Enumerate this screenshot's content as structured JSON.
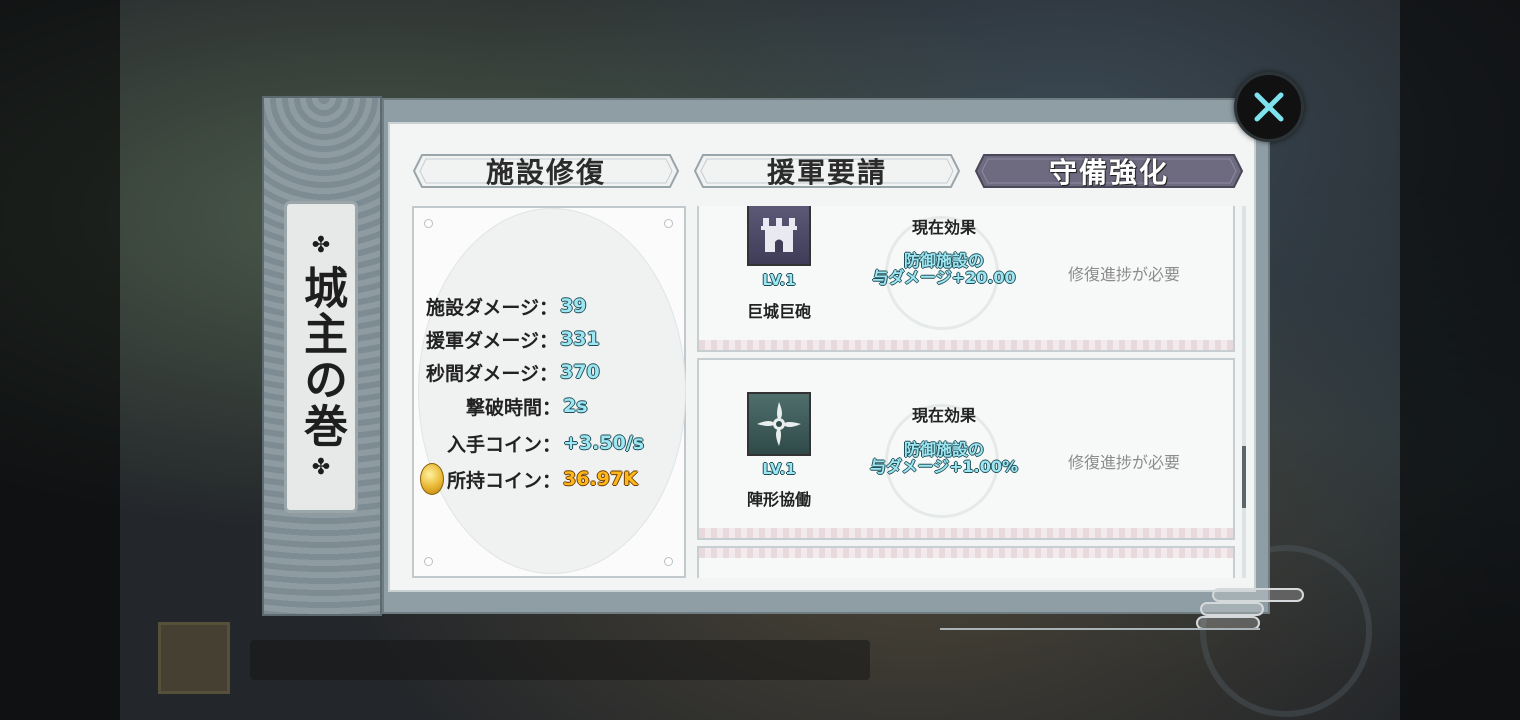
{
  "side_title": "城主の巻",
  "tabs": [
    {
      "label": "施設修復",
      "active": false
    },
    {
      "label": "援軍要請",
      "active": false
    },
    {
      "label": "守備強化",
      "active": true
    }
  ],
  "stats": [
    {
      "label": "施設ダメージ：",
      "value": "39"
    },
    {
      "label": "援軍ダメージ：",
      "value": "331"
    },
    {
      "label": "秒間ダメージ：",
      "value": "370"
    },
    {
      "label": "撃破時間：",
      "value": "2s"
    },
    {
      "label": "入手コイン：",
      "value": "+3.50/s"
    },
    {
      "label": "所持コイン：",
      "value": "36.97K"
    }
  ],
  "items": [
    {
      "icon": "castle-tower-icon",
      "level": "LV.1",
      "name": "巨城巨砲",
      "effect_title": "現在効果",
      "effect_line1": "防御施設の",
      "effect_line2": "与ダメージ+20.00",
      "note": "修復進捗が必要"
    },
    {
      "icon": "shuriken-icon",
      "level": "LV.1",
      "name": "陣形協働",
      "effect_title": "現在効果",
      "effect_line1": "防御施設の",
      "effect_line2": "与ダメージ+1.00%",
      "note": "修復進捗が必要"
    }
  ],
  "colors": {
    "accent_cyan": "#9ee6f2",
    "coin_gold": "#ffb71c",
    "active_tab": "#6e6a80"
  }
}
